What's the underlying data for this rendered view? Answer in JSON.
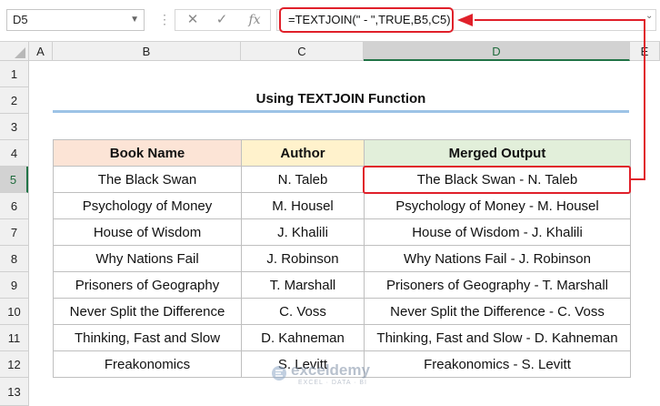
{
  "formula_bar": {
    "name_box": "D5",
    "fx_label": "fx",
    "formula": "=TEXTJOIN(\" - \",TRUE,B5,C5)"
  },
  "sheet": {
    "columns": [
      "A",
      "B",
      "C",
      "D",
      "E"
    ],
    "rows": [
      "1",
      "2",
      "3",
      "4",
      "5",
      "6",
      "7",
      "8",
      "9",
      "10",
      "11",
      "12",
      "13"
    ],
    "selected_cell": "D5",
    "title": "Using TEXTJOIN Function",
    "headers": [
      "Book Name",
      "Author",
      "Merged Output"
    ],
    "header_colors": [
      "#fce4d6",
      "#fff2cc",
      "#e2efda"
    ],
    "data": [
      [
        "The Black Swan",
        "N. Taleb",
        "The Black Swan - N. Taleb"
      ],
      [
        "Psychology of Money",
        "M. Housel",
        "Psychology of Money - M. Housel"
      ],
      [
        "House of Wisdom",
        "J. Khalili",
        "House of Wisdom - J. Khalili"
      ],
      [
        "Why Nations Fail",
        "J. Robinson",
        "Why Nations Fail - J. Robinson"
      ],
      [
        "Prisoners of Geography",
        "T. Marshall",
        "Prisoners of Geography - T. Marshall"
      ],
      [
        "Never Split the Difference",
        "C. Voss",
        "Never Split the Difference - C. Voss"
      ],
      [
        "Thinking, Fast and Slow",
        "D. Kahneman",
        "Thinking, Fast and Slow - D. Kahneman"
      ],
      [
        "Freakonomics",
        "S. Levitt",
        "Freakonomics - S. Levitt"
      ]
    ]
  },
  "watermark": {
    "brand": "exceldemy",
    "tagline": "EXCEL · DATA · BI"
  },
  "colors": {
    "highlight": "#e0202a",
    "accent": "#217346"
  }
}
